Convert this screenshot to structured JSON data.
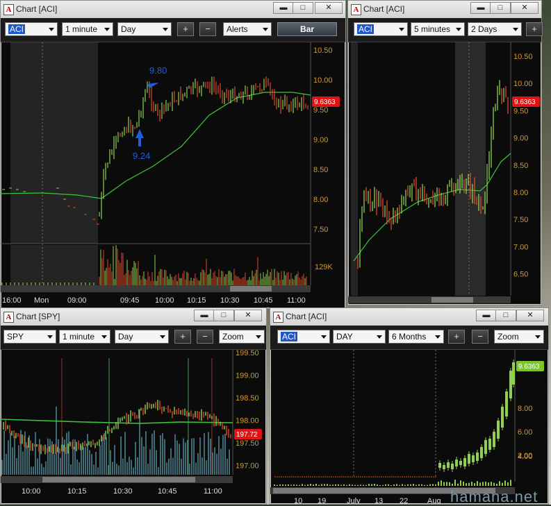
{
  "colors": {
    "up": "#8fd14f",
    "down": "#e04a2a",
    "ma": "#3cc83c",
    "axis": "#d29a2a",
    "last_up": "#7dc42c",
    "last_down": "#e01414",
    "annot": "#1e5fd8"
  },
  "windows": [
    {
      "id": "w1",
      "title": "Chart [ACI]",
      "symbol": "ACI",
      "interval": "1 minute",
      "range": "Day",
      "alerts": "Alerts",
      "style": "Bar",
      "price_ticks": [
        "10.50",
        "10.00",
        "9.50",
        "9.00",
        "8.50",
        "8.00",
        "7.50"
      ],
      "last": "9.6363",
      "volume_label": "129K",
      "time_labels": [
        "16:00",
        "Mon",
        "09:00",
        "09:45",
        "10:00",
        "10:15",
        "10:30",
        "10:45",
        "11:00"
      ],
      "annotations": [
        {
          "text": "9.80"
        },
        {
          "text": "9.24"
        }
      ]
    },
    {
      "id": "w2",
      "title": "Chart [ACI]",
      "symbol": "ACI",
      "interval": "5 minutes",
      "range": "2 Days",
      "price_ticks": [
        "10.50",
        "10.00",
        "9.50",
        "9.00",
        "8.50",
        "8.00",
        "7.50",
        "7.00",
        "6.50"
      ],
      "last": "9.6363"
    },
    {
      "id": "w3",
      "title": "Chart [SPY]",
      "symbol": "SPY",
      "interval": "1 minute",
      "range": "Day",
      "zoom": "Zoom",
      "price_ticks": [
        "199.50",
        "199.00",
        "198.50",
        "198.00",
        "197.50",
        "197.00"
      ],
      "last": "197.72",
      "time_labels": [
        "10:00",
        "10:15",
        "10:30",
        "10:45",
        "11:00"
      ]
    },
    {
      "id": "w4",
      "title": "Chart [ACI]",
      "symbol": "ACI",
      "interval": "DAY",
      "range": "6 Months",
      "zoom": "Zoom",
      "price_ticks": [
        "8.00",
        "6.00",
        "4.00",
        "2.00"
      ],
      "last": "9.6363",
      "time_labels": [
        "10",
        "19",
        "July",
        "13",
        "22",
        "Aug"
      ]
    }
  ],
  "watermark": "hamana.net"
}
